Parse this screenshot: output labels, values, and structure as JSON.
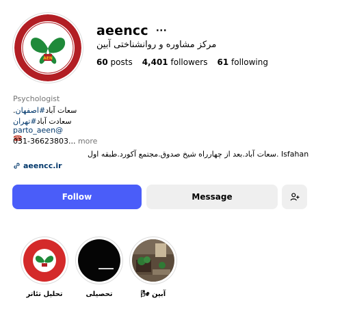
{
  "profile": {
    "username": "aeencc",
    "more_icon": "···",
    "full_name": "مرکز مشاوره و روانشناختی آبین",
    "stats": {
      "posts_count": "60",
      "posts_label": "posts",
      "followers_count": "4,401",
      "followers_label": "followers",
      "following_count": "61",
      "following_label": "following"
    }
  },
  "bio": {
    "category": "Psychologist",
    "line1_hash": "#اصفهان",
    "line1_text": ".سعات آباد",
    "line2_hash": "#تهران",
    "line2_text": "سعادت آباد",
    "line3_mention": "parto_aeen@",
    "line4_phone_icon": "☎",
    "line5_text": "031-36623803...",
    "more_label": "more",
    "address": "سعات آباد.بعد از چهارراه شیخ صدوق.مجتمع آکورد.طبقه اول. Isfahan"
  },
  "external_link": {
    "label": "aeencc.ir",
    "icon": "link-icon"
  },
  "actions": {
    "follow_label": "Follow",
    "message_label": "Message",
    "add_user_icon": "add-user-icon"
  },
  "highlights": [
    {
      "label": "تحلیل تئاتر"
    },
    {
      "label": "تحصیلی"
    },
    {
      "label": "آبین 🌬"
    }
  ],
  "colors": {
    "follow_button": "#4a5df9",
    "secondary_button": "#efefef",
    "link": "#00376b",
    "muted": "#737373"
  }
}
